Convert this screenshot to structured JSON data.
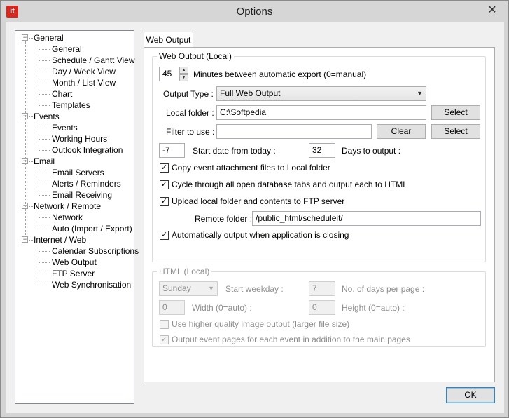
{
  "window": {
    "title": "Options",
    "app_icon_text": "it"
  },
  "tree": {
    "groups": [
      {
        "label": "General",
        "children": [
          "General",
          "Schedule / Gantt View",
          "Day / Week View",
          "Month / List View",
          "Chart",
          "Templates"
        ]
      },
      {
        "label": "Events",
        "children": [
          "Events",
          "Working Hours",
          "Outlook Integration"
        ]
      },
      {
        "label": "Email",
        "children": [
          "Email Servers",
          "Alerts / Reminders",
          "Email Receiving"
        ]
      },
      {
        "label": "Network / Remote",
        "children": [
          "Network",
          "Auto (Import / Export)"
        ]
      },
      {
        "label": "Internet / Web",
        "children": [
          "Calendar Subscriptions",
          "Web Output",
          "FTP Server",
          "Web Synchronisation"
        ]
      }
    ]
  },
  "tab": {
    "label": "Web Output"
  },
  "web_local": {
    "legend": "Web Output (Local)",
    "minutes_value": "45",
    "minutes_label": "Minutes between automatic export (0=manual)",
    "output_type_label": "Output Type :",
    "output_type_value": "Full Web Output",
    "local_folder_label": "Local folder :",
    "local_folder_value": "C:\\Softpedia",
    "select_label": "Select",
    "filter_label": "Filter to use :",
    "filter_value": "",
    "clear_label": "Clear",
    "start_date_value": "-7",
    "start_date_label": "Start date from today :",
    "days_output_value": "32",
    "days_output_label": "Days to output :",
    "copy_attachments_label": "Copy event attachment files to Local folder",
    "copy_attachments_checked": true,
    "cycle_tabs_label": "Cycle through all open database tabs and output each to HTML",
    "cycle_tabs_checked": true,
    "upload_ftp_label": "Upload local folder and contents to FTP server",
    "upload_ftp_checked": true,
    "remote_folder_label": "Remote folder :",
    "remote_folder_value": "/public_html/scheduleit/",
    "auto_output_label": "Automatically output when application is closing",
    "auto_output_checked": true
  },
  "html_local": {
    "legend": "HTML (Local)",
    "start_weekday_value": "Sunday",
    "start_weekday_label": "Start weekday :",
    "days_per_page_value": "7",
    "days_per_page_label": "No. of days per page :",
    "width_value": "0",
    "width_label": "Width (0=auto) :",
    "height_value": "0",
    "height_label": "Height (0=auto) :",
    "higher_quality_label": "Use higher quality image output (larger file size)",
    "higher_quality_checked": false,
    "event_pages_label": "Output event pages for each event in addition to the main pages",
    "event_pages_checked": true
  },
  "footer": {
    "ok_label": "OK"
  }
}
